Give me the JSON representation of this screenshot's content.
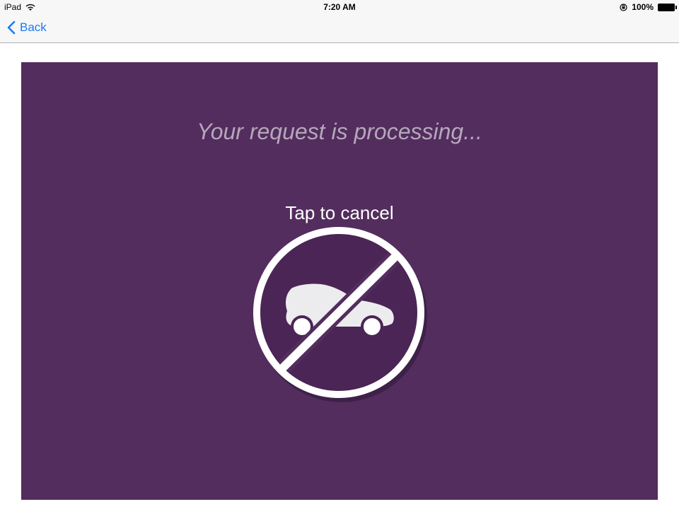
{
  "status_bar": {
    "device": "iPad",
    "time": "7:20 AM",
    "battery": "100%"
  },
  "nav": {
    "back_label": "Back"
  },
  "main": {
    "processing_text": "Your request is processing...",
    "cancel_label": "Tap to cancel"
  },
  "colors": {
    "panel": "#532d5e",
    "accent": "#1a7cf2"
  },
  "icons": {
    "wifi": "wifi-icon",
    "lock": "orientation-lock-icon",
    "battery": "battery-icon",
    "back": "chevron-left-icon",
    "cancel": "no-car-icon"
  }
}
